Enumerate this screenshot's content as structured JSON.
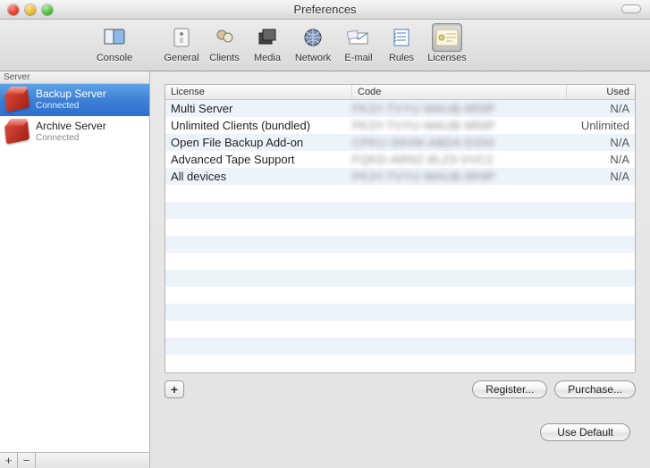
{
  "window": {
    "title": "Preferences"
  },
  "toolbar": {
    "items": [
      {
        "id": "console",
        "label": "Console",
        "icon": "console-icon"
      },
      {
        "id": "general",
        "label": "General",
        "icon": "general-icon"
      },
      {
        "id": "clients",
        "label": "Clients",
        "icon": "clients-icon"
      },
      {
        "id": "media",
        "label": "Media",
        "icon": "media-icon"
      },
      {
        "id": "network",
        "label": "Network",
        "icon": "network-icon"
      },
      {
        "id": "email",
        "label": "E-mail",
        "icon": "email-icon"
      },
      {
        "id": "rules",
        "label": "Rules",
        "icon": "rules-icon"
      },
      {
        "id": "licenses",
        "label": "Licenses",
        "icon": "licenses-icon",
        "selected": true
      }
    ]
  },
  "sidebar": {
    "header": "Server",
    "servers": [
      {
        "name": "Backup Server",
        "status": "Connected",
        "selected": true
      },
      {
        "name": "Archive Server",
        "status": "Connected",
        "selected": false
      }
    ],
    "add_label": "+",
    "remove_label": "−"
  },
  "table": {
    "columns": {
      "license": "License",
      "code": "Code",
      "used": "Used"
    },
    "rows": [
      {
        "license": "Multi Server",
        "code": "PK3Y-TVYU-WAUB-9R9P",
        "used": "N/A"
      },
      {
        "license": "Unlimited Clients (bundled)",
        "code": "PK3Y-TVYU-WAUB-9R9P",
        "used": "Unlimited"
      },
      {
        "license": "Open File Backup Add-on",
        "code": "CPKU-S9VM-ABD4-D334",
        "used": "N/A"
      },
      {
        "license": "Advanced Tape Support",
        "code": "FQKD-ARNZ-8LZ3-VVC2",
        "used": "N/A"
      },
      {
        "license": "All devices",
        "code": "PK3Y-TVYU-WAUB-9R9P",
        "used": "N/A"
      }
    ]
  },
  "buttons": {
    "add": "+",
    "register": "Register...",
    "purchase": "Purchase...",
    "use_default": "Use Default"
  }
}
